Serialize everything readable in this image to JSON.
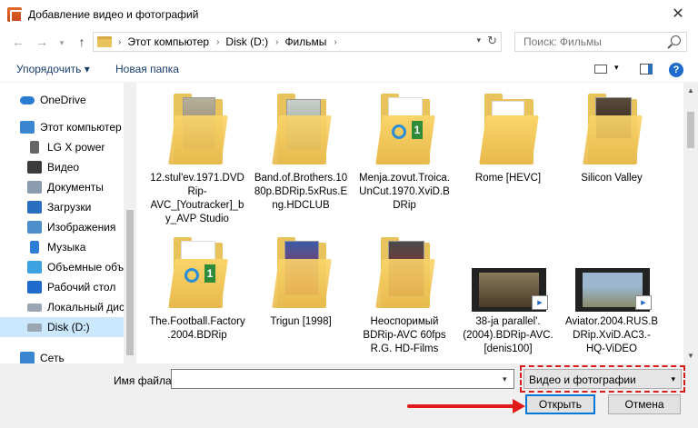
{
  "window": {
    "title": "Добавление видео и фотографий"
  },
  "address": {
    "crumbs": [
      "Этот компьютер",
      "Disk (D:)",
      "Фильмы"
    ]
  },
  "search": {
    "placeholder": "Поиск: Фильмы"
  },
  "toolbar": {
    "arrange_label": "Упорядочить ▾",
    "new_folder_label": "Новая папка",
    "help": "?"
  },
  "sidebar": {
    "items": [
      {
        "label": "OneDrive",
        "icon": "cloud-icon"
      },
      {
        "label": "Этот компьютер",
        "icon": "computer-icon"
      },
      {
        "label": "LG X power",
        "icon": "phone-icon"
      },
      {
        "label": "Видео",
        "icon": "video-icon"
      },
      {
        "label": "Документы",
        "icon": "document-icon"
      },
      {
        "label": "Загрузки",
        "icon": "download-icon"
      },
      {
        "label": "Изображения",
        "icon": "image-icon"
      },
      {
        "label": "Музыка",
        "icon": "music-icon"
      },
      {
        "label": "Объемные объе",
        "icon": "3d-objects-icon"
      },
      {
        "label": "Рабочий стол",
        "icon": "desktop-icon"
      },
      {
        "label": "Локальный диск",
        "icon": "drive-icon"
      },
      {
        "label": "Disk (D:)",
        "icon": "drive-icon"
      },
      {
        "label": "Сеть",
        "icon": "network-icon"
      }
    ]
  },
  "files": [
    {
      "label": "12.stul'ev.1971.DVDRip-AVC_[Youtracker]_by_AVP Studio"
    },
    {
      "label": "Band.of.Brothers.1080p.BDRip.5xRus.Eng.HDCLUB"
    },
    {
      "label": "Menja.zovut.Troica.UnCut.1970.XviD.BDRip"
    },
    {
      "label": "Rome [HEVC]"
    },
    {
      "label": "Silicon Valley"
    },
    {
      "label": "The.Football.Factory.2004.BDRip"
    },
    {
      "label": "Trigun [1998]"
    },
    {
      "label": "Неоспоримый BDRip-AVC 60fps R.G. HD-Films"
    },
    {
      "label": "38-ja parallel'.(2004).BDRip-AVC.[denis100]"
    },
    {
      "label": "Aviator.2004.RUS.BDRip.XviD.AC3.-HQ-ViDEO"
    }
  ],
  "bottom": {
    "filename_label": "Имя файла:",
    "filename_value": "",
    "filetype_value": "Видео и фотографии",
    "open_label": "Открыть",
    "cancel_label": "Отмена"
  },
  "colors": {
    "accent": "#0078d7",
    "highlight": "#d81b1b",
    "folder": "#e8c25a",
    "selected": "#cce8ff"
  }
}
